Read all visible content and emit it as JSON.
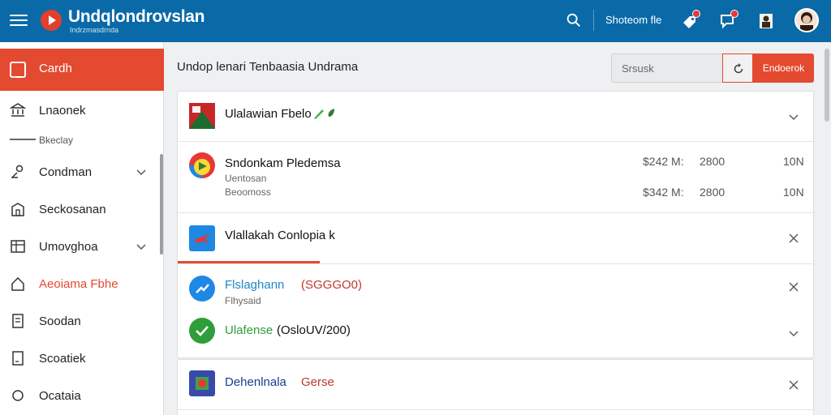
{
  "header": {
    "title": "Undqlondrovslan",
    "subtitle": "Indrzmasdrnda",
    "link_label": "Shoteom fle"
  },
  "sidebar": {
    "active": {
      "label": "Cardh"
    },
    "items": [
      {
        "label": "Lnaonek"
      },
      {
        "label": "Seckosanan"
      },
      {
        "label": "Umovghoa"
      },
      {
        "label": "Aeoiama Fbhe"
      },
      {
        "label": "Soodan"
      },
      {
        "label": "Scoatiek"
      },
      {
        "label": "Ocataia"
      }
    ],
    "sub_item": {
      "label": "Bkeclay"
    },
    "condman": {
      "label": "Condman"
    }
  },
  "main": {
    "title": "Undop lenari Tenbaasia Undrama",
    "search_placeholder": "Srsusk",
    "action_label": "Endoerok"
  },
  "list": {
    "row1": {
      "title": "Ulalawian Fbelo"
    },
    "row2": {
      "title": "Sndonkam Pledemsa",
      "line1": "Uentosan",
      "line2": "Beoomoss",
      "values": [
        {
          "amount": "$242 M:",
          "count": "2800",
          "unit": "10N"
        },
        {
          "amount": "$342 M:",
          "count": "2800",
          "unit": "10N"
        }
      ]
    },
    "row3": {
      "title": "Vlallakah Conlopia k"
    },
    "row4": {
      "title": "Flslaghann",
      "tag": "(SGGGO0)",
      "sub": "Flhysaid"
    },
    "row5": {
      "title": "Ulafense",
      "tag": "(OsloUV/200)"
    },
    "row6": {
      "title": "Dehenlnala",
      "tag": "Gerse"
    }
  },
  "colors": {
    "topbar": "#0a6aa8",
    "accent": "#e34a30",
    "link_blue": "#1e88c8",
    "success_green": "#2e9e3a"
  }
}
